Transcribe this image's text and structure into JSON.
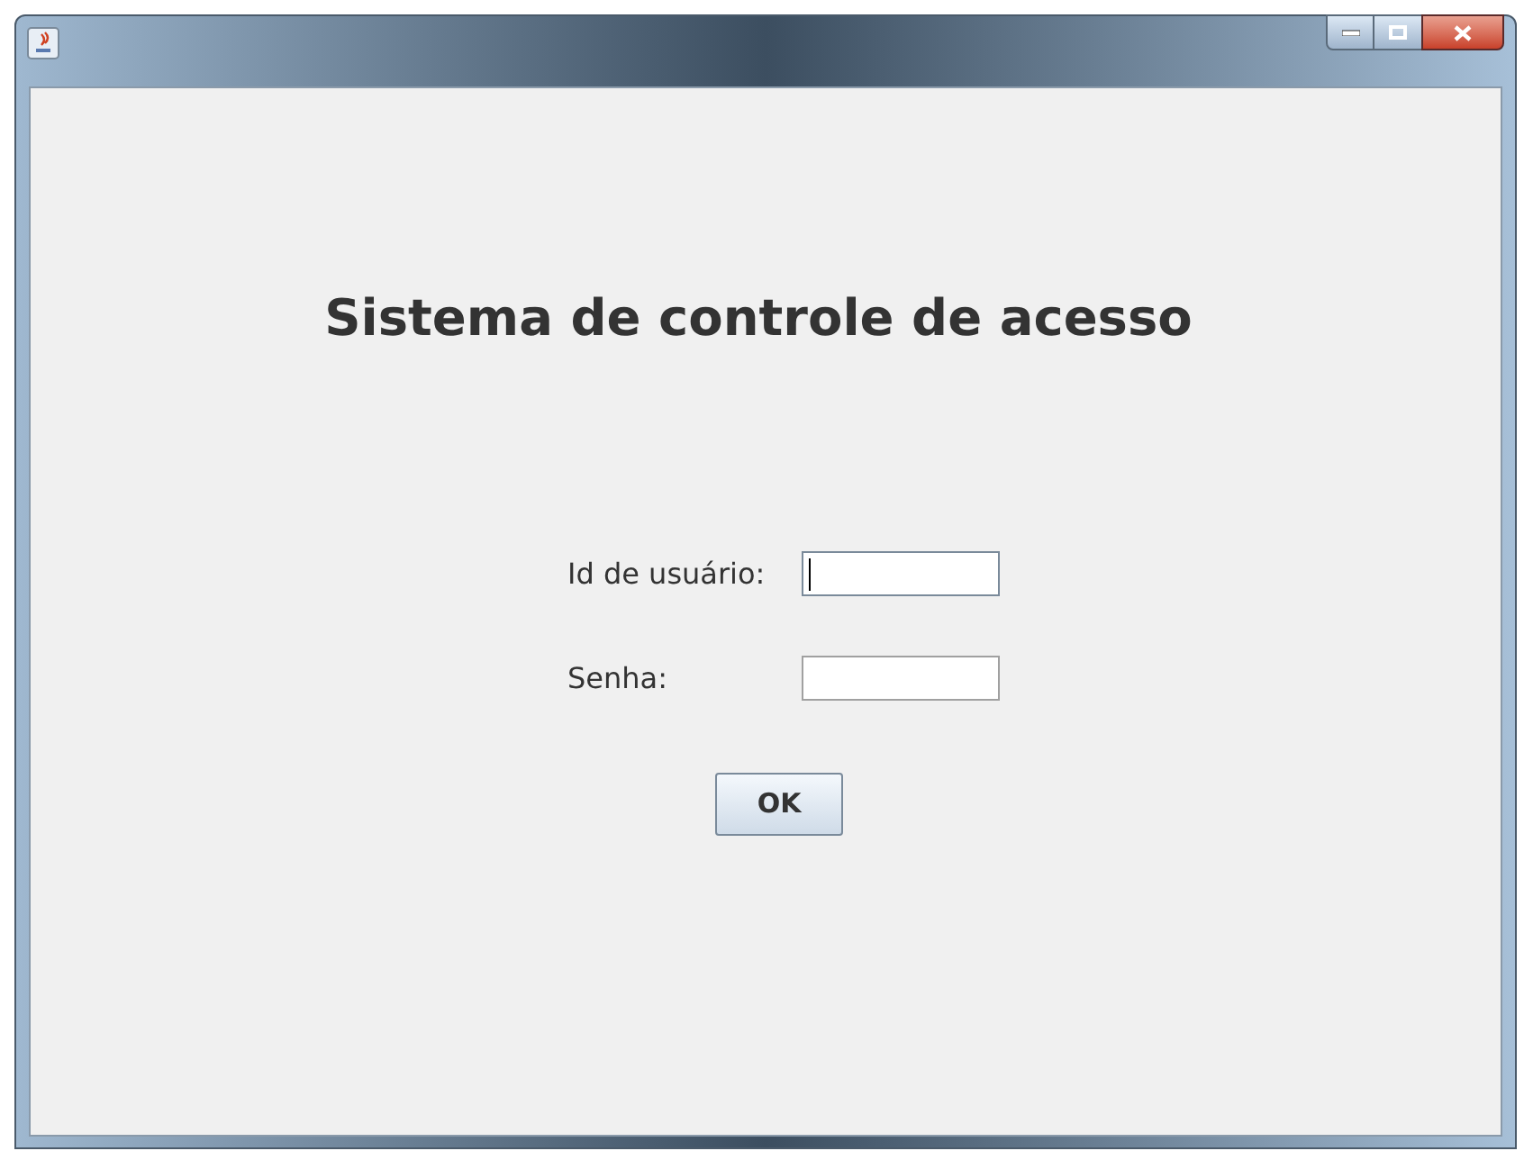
{
  "heading": "Sistema de controle de acesso",
  "fields": [
    {
      "label": "Id de usuário:",
      "focused": true
    },
    {
      "label": "Senha:",
      "focused": false
    }
  ],
  "button": "OK"
}
